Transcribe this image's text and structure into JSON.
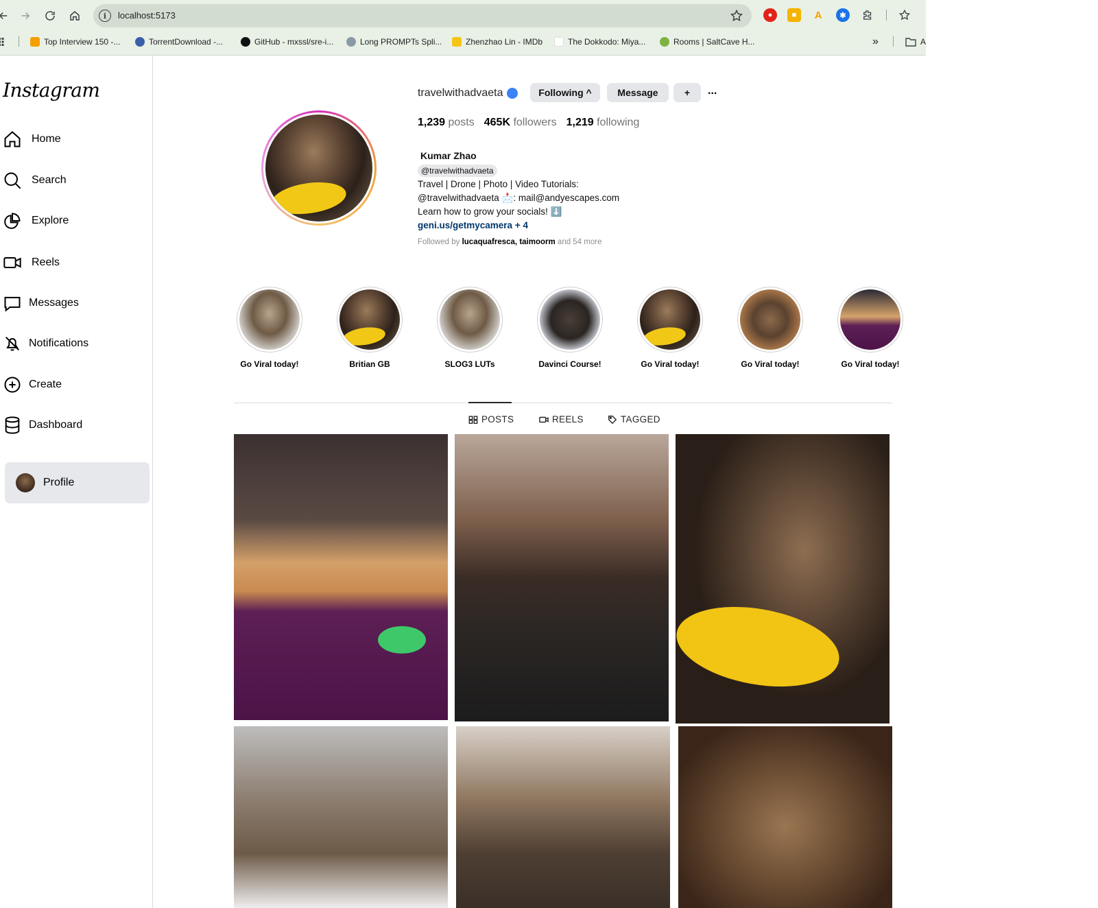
{
  "browser": {
    "url": "localhost:5173",
    "bookmarks": [
      {
        "label": "Top Interview 150 -...",
        "color": "#f4a000"
      },
      {
        "label": "TorrentDownload -...",
        "color": "#3b5fa8"
      },
      {
        "label": "GitHub - mxssl/sre-i...",
        "color": "#111111"
      },
      {
        "label": "Long PROMPTs Spli...",
        "color": "#8a9aa8"
      },
      {
        "label": "Zhenzhao Lin - IMDb",
        "color": "#f5c518"
      },
      {
        "label": "The Dokkodo: Miya...",
        "color": "#ffffff"
      },
      {
        "label": "Rooms | SaltCave H...",
        "color": "#7cb342"
      }
    ],
    "overflow": "»",
    "folder_label": "A"
  },
  "sidebar": {
    "logo": "Instagram",
    "items": [
      {
        "label": "Home",
        "icon": "home-icon"
      },
      {
        "label": "Search",
        "icon": "search-icon"
      },
      {
        "label": "Explore",
        "icon": "explore-icon"
      },
      {
        "label": "Reels",
        "icon": "reels-icon"
      },
      {
        "label": "Messages",
        "icon": "messages-icon"
      },
      {
        "label": "Notifications",
        "icon": "notifications-icon"
      },
      {
        "label": "Create",
        "icon": "create-icon"
      },
      {
        "label": "Dashboard",
        "icon": "dashboard-icon"
      }
    ],
    "profile_label": "Profile"
  },
  "profile": {
    "username": "travelwithadvaeta",
    "following_btn": "Following ^",
    "message_btn": "Message",
    "plus_btn": "+",
    "more": "...",
    "posts_count": "1,239",
    "posts_label": "posts",
    "followers_count": "465K",
    "followers_label": "followers",
    "following_count": "1,219",
    "following_label": "following",
    "full_name": "Kumar Zhao",
    "handle_chip": "@travelwithadvaeta",
    "bio_line1": "Travel | Drone | Photo | Video Tutorials:",
    "bio_line2": "@travelwithadvaeta 📩: mail@andyescapes.com",
    "bio_line3": "Learn how to grow your socials! ⬇️",
    "bio_link": "geni.us/getmycamera + 4",
    "followed_prefix": "Followed by",
    "followed_names": "lucaquafresca, taimoorm",
    "followed_suffix": "and 54 more"
  },
  "highlights": [
    {
      "label": "Go Viral today!"
    },
    {
      "label": "Britian GB"
    },
    {
      "label": "SLOG3 LUTs"
    },
    {
      "label": "Davinci Course!"
    },
    {
      "label": "Go Viral today!"
    },
    {
      "label": "Go Viral today!"
    },
    {
      "label": "Go Viral today!"
    }
  ],
  "tabs": [
    {
      "label": "POSTS",
      "active": true
    },
    {
      "label": "REELS",
      "active": false
    },
    {
      "label": "TAGGED",
      "active": false
    }
  ],
  "colors": {
    "accent_blue": "#3b82f6",
    "link": "#00376b",
    "active_nav_bg": "#e6e8ec"
  }
}
